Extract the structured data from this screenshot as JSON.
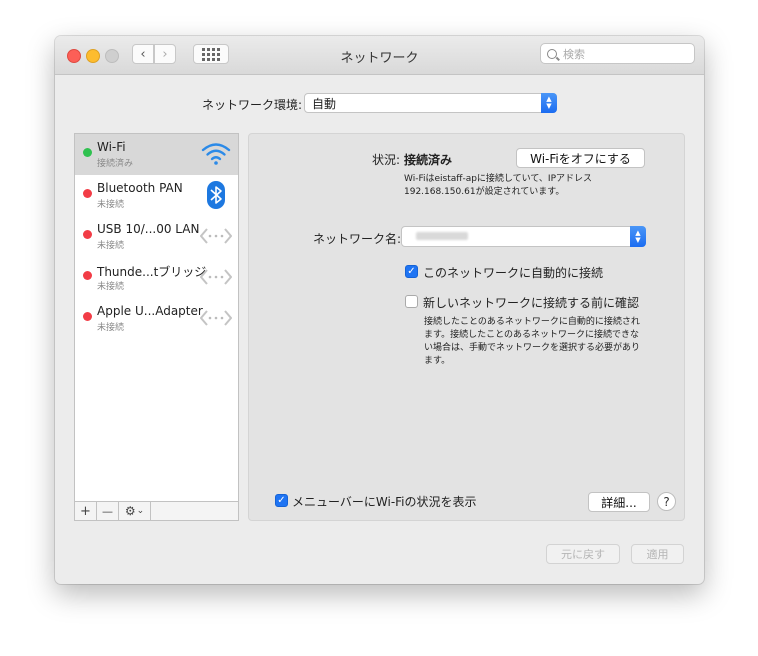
{
  "window": {
    "title": "ネットワーク"
  },
  "search": {
    "placeholder": "検索"
  },
  "location": {
    "label": "ネットワーク環境:",
    "value": "自動"
  },
  "services": [
    {
      "name": "Wi-Fi",
      "status": "接続済み",
      "state": "green",
      "icon": "wifi-icon",
      "selected": true
    },
    {
      "name": "Bluetooth PAN",
      "status": "未接続",
      "state": "red",
      "icon": "bluetooth-icon"
    },
    {
      "name": "USB 10/...00 LAN",
      "status": "未接続",
      "state": "red",
      "icon": "ethernet-icon"
    },
    {
      "name": "Thunde...tブリッジ",
      "status": "未接続",
      "state": "red",
      "icon": "ethernet-icon"
    },
    {
      "name": "Apple U...Adapter",
      "status": "未接続",
      "state": "red",
      "icon": "ethernet-icon"
    }
  ],
  "sidebar_toolbar": {
    "add": "+",
    "remove": "—",
    "gear": "⚙",
    "gear_chevron": "⌄"
  },
  "detail": {
    "status_label": "状況:",
    "status_value": "接続済み",
    "toggle_wifi": "Wi-Fiをオフにする",
    "status_desc_1": "Wi-Fiはeistaff-apに接続していて、IPアドレス",
    "status_desc_2": "192.168.150.61が設定されています。",
    "network_name_label": "ネットワーク名:",
    "auto_join_label": "このネットワークに自動的に接続",
    "auto_join_checked": true,
    "ask_join_label": "新しいネットワークに接続する前に確認",
    "ask_join_checked": false,
    "ask_desc_1": "接続したことのあるネットワークに自動的に接続され",
    "ask_desc_2": "ます。接続したことのあるネットワークに接続できな",
    "ask_desc_3": "い場合は、手動でネットワークを選択する必要があり",
    "ask_desc_4": "ます。",
    "menubar_label": "メニューバーにWi-Fiの状況を表示",
    "menubar_checked": true,
    "advanced": "詳細...",
    "help": "?"
  },
  "footer": {
    "revert": "元に戻す",
    "apply": "適用"
  },
  "colors": {
    "accent": "#1f74f3",
    "connected": "#2fc14f",
    "disconnected": "#f23c46"
  }
}
